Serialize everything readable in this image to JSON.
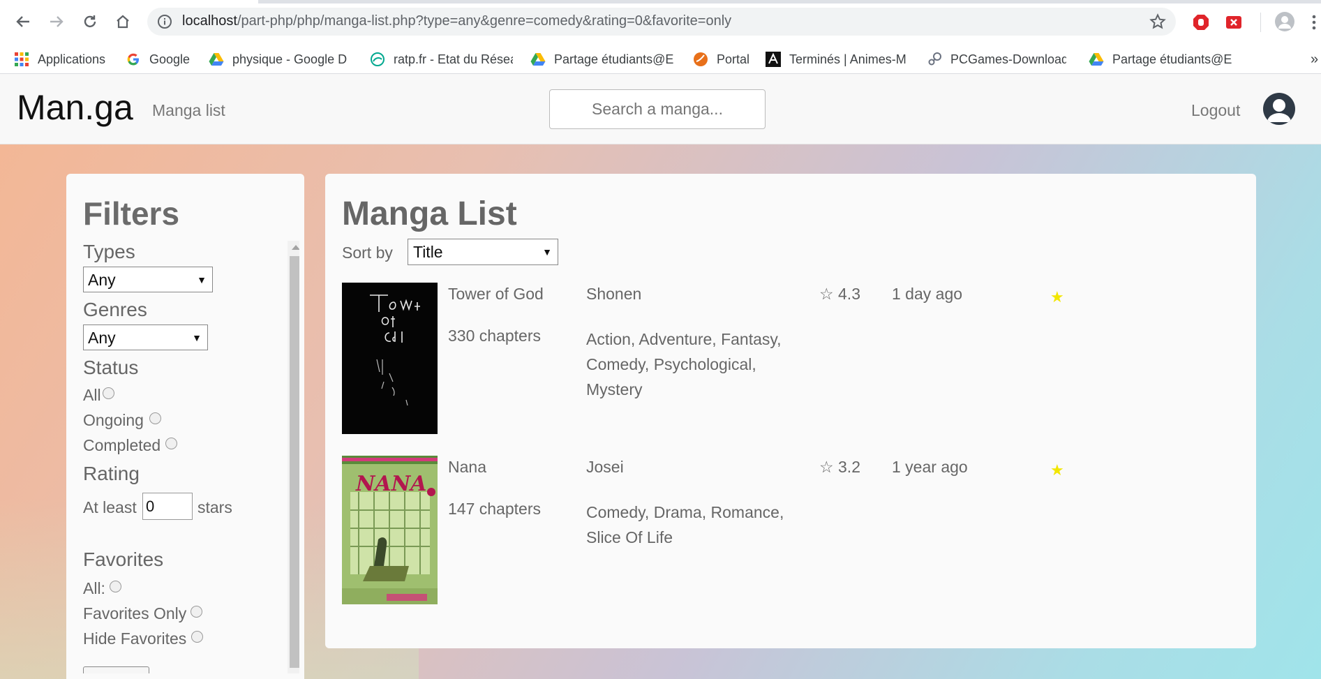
{
  "browser": {
    "url_host": "localhost",
    "url_path": "/part-php/php/manga-list.php?type=any&genre=comedy&rating=0&favorite=only",
    "bookmarks": [
      {
        "label": "Applications",
        "icon": "apps-grid-icon"
      },
      {
        "label": "Google",
        "icon": "google-icon"
      },
      {
        "label": "physique - Google D",
        "icon": "drive-icon"
      },
      {
        "label": "ratp.fr - Etat du Résea",
        "icon": "ratp-icon"
      },
      {
        "label": "Partage étudiants@E",
        "icon": "drive-icon"
      },
      {
        "label": "Portal",
        "icon": "portal-icon"
      },
      {
        "label": "Terminés | Animes-M",
        "icon": "animes-icon"
      },
      {
        "label": "PCGames-Download",
        "icon": "steam-icon"
      },
      {
        "label": "Partage étudiants@E",
        "icon": "drive-icon"
      }
    ],
    "overflow": "»"
  },
  "navbar": {
    "brand": "Man.ga",
    "link": "Manga list",
    "search_placeholder": "Search a manga...",
    "logout": "Logout"
  },
  "filters": {
    "title": "Filters",
    "types_label": "Types",
    "types_value": "Any",
    "genres_label": "Genres",
    "genres_value": "Any",
    "status_label": "Status",
    "status_options": [
      "All",
      "Ongoing",
      "Completed"
    ],
    "rating_label": "Rating",
    "rating_prefix": "At least",
    "rating_value": "0",
    "rating_suffix": "stars",
    "favorites_label": "Favorites",
    "favorites_options": [
      "All:",
      "Favorites Only",
      "Hide Favorites"
    ]
  },
  "main": {
    "title": "Manga List",
    "sort_label": "Sort by",
    "sort_value": "Title",
    "mangas": [
      {
        "title": "Tower of God",
        "chapters": "330 chapters",
        "type": "Shonen",
        "genres": "Action, Adventure, Fantasy, Comedy, Psychological, Mystery",
        "rating": "☆ 4.3",
        "updated": "1 day ago",
        "favorite": "★"
      },
      {
        "title": "Nana",
        "chapters": "147 chapters",
        "type": "Josei",
        "genres": "Comedy, Drama, Romance, Slice Of Life",
        "rating": "☆ 3.2",
        "updated": "1 year ago",
        "favorite": "★"
      }
    ]
  },
  "colors": {
    "favorite_star": "#f2e600",
    "text_muted": "#666666",
    "navbar_bg": "#f8f8f8"
  }
}
